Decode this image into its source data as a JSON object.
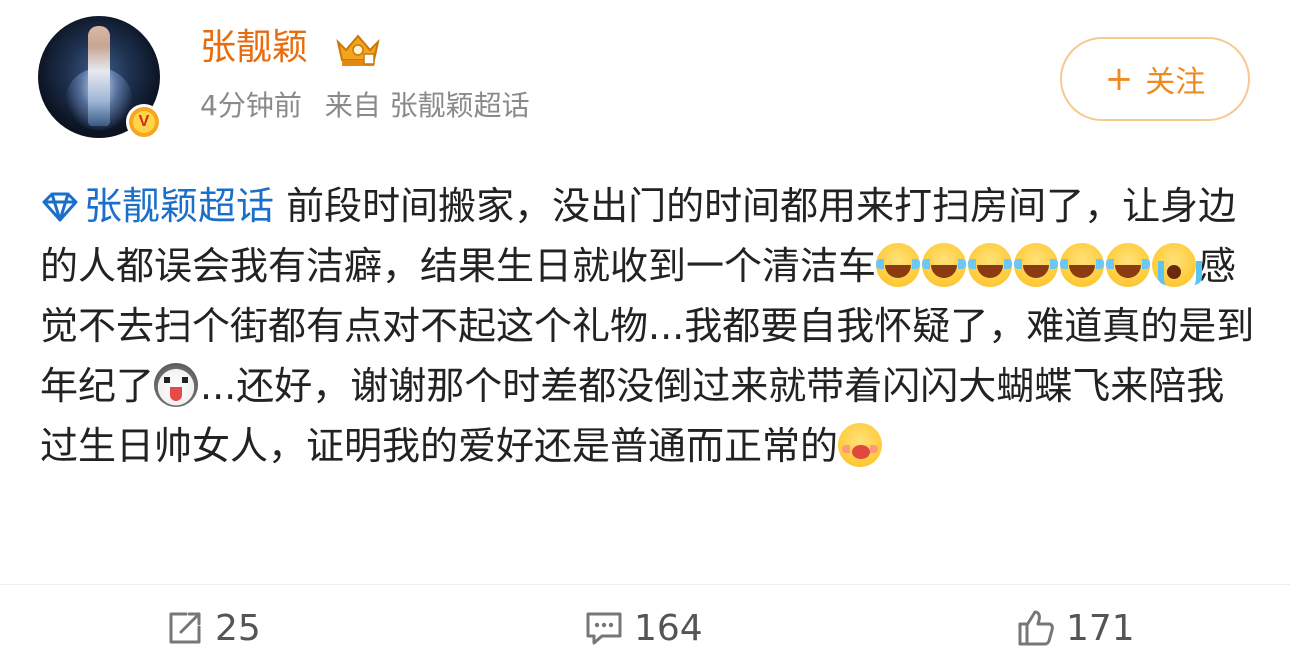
{
  "user": {
    "name": "张靓颖",
    "verified_badge": "V"
  },
  "meta": {
    "time": "4分钟前",
    "source": "来自 张靓颖超话"
  },
  "follow": {
    "label": "关注"
  },
  "post": {
    "topic": "张靓颖超话",
    "text1": " 前段时间搬家，没出门的时间都用来打扫房间了，让身边的人都误会我有洁癖，结果生日就收到一个清洁车",
    "text2": "感觉不去扫个街都有点对不起这个礼物...我都要自我怀疑了，难道真的是到年纪了",
    "text3": "...还好，谢谢那个时差都没倒过来就带着闪闪大蝴蝶飞来陪我过生日帅女人，证明我的爱好还是普通而正常的"
  },
  "actions": {
    "repost_count": "25",
    "comment_count": "164",
    "like_count": "171"
  },
  "icons": {
    "crown": "crown-badge-icon",
    "diamond": "super-topic-diamond-icon",
    "repost": "repost-icon",
    "comment": "comment-icon",
    "like": "thumbs-up-icon"
  },
  "colors": {
    "username": "#e86b0c",
    "topic_link": "#1b6fc9",
    "follow_text": "#f08a20",
    "follow_border": "#f7c891"
  }
}
